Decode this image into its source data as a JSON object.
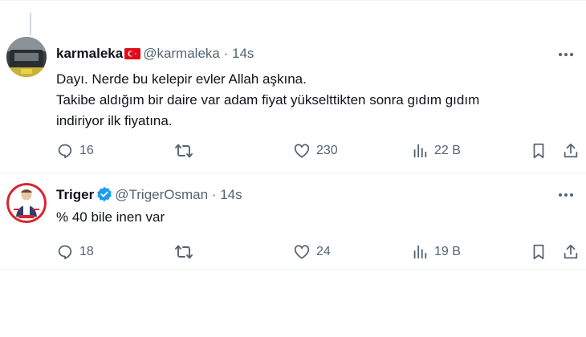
{
  "tweets": [
    {
      "display_name": "karmaleka",
      "handle": "@karmaleka",
      "separator": "·",
      "time": "14s",
      "text_lines": [
        "Dayı. Nerde bu kelepir evler Allah aşkına.",
        "Takibe aldığım bir daire var adam fiyat yükselttikten sonra gıdım gıdım",
        "indiriyor ilk fiyatına."
      ],
      "replies": "16",
      "likes": "230",
      "views": "22 B"
    },
    {
      "display_name": "Triger",
      "handle": "@TrigerOsman",
      "separator": "·",
      "time": "14s",
      "text_lines": [
        "% 40 bile inen var"
      ],
      "replies": "18",
      "likes": "24",
      "views": "19 B"
    }
  ],
  "icons": {
    "more": "more-dots-icon",
    "reply": "reply-icon",
    "retweet": "retweet-icon",
    "like": "heart-icon",
    "views": "analytics-icon",
    "bookmark": "bookmark-icon",
    "share": "share-icon",
    "flag": "turkey-flag-icon",
    "verified": "verified-badge-icon"
  },
  "colors": {
    "verified": "#1d9bf0",
    "secondary_text": "#536471",
    "flag_red": "#e30a17"
  }
}
